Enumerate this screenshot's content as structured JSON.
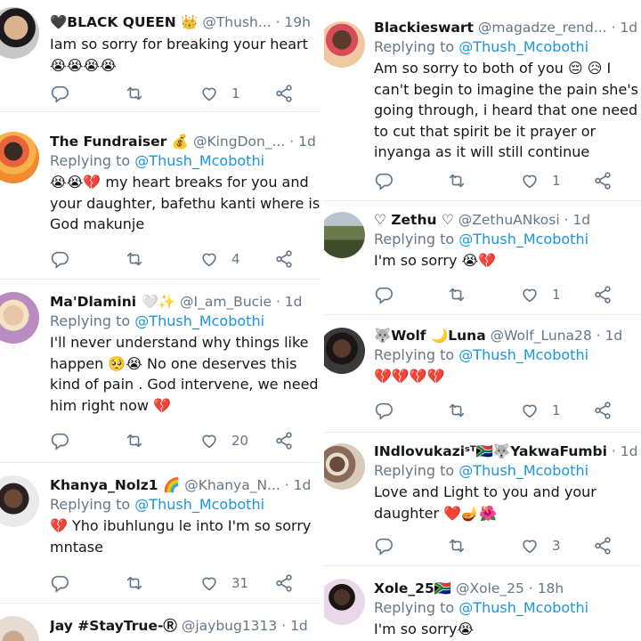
{
  "colors": {
    "mention": "#1b95e0",
    "muted": "#657786",
    "text": "#14171a",
    "divider": "#e6ecf0"
  },
  "left": [
    {
      "name": "🖤BLACK QUEEN 👑",
      "handle": "@Thush...",
      "time": "· 19h",
      "reply_prefix": "",
      "mention": "",
      "text": "Iam so sorry for breaking your heart 😭😭😭😭",
      "replies": "",
      "retweets": "",
      "likes": "1"
    },
    {
      "name": "The Fundraiser 💰",
      "handle": "@KingDon_...",
      "time": "· 1d",
      "reply_prefix": "Replying to ",
      "mention": "@Thush_Mcobothi",
      "text": "😭😭💔 my heart breaks for you and your daughter, bafethu kanti where is God makunje",
      "replies": "",
      "retweets": "",
      "likes": "4"
    },
    {
      "name": "Ma'Dlamini 🤍✨",
      "handle": "@I_am_Bucie",
      "time": "· 1d",
      "reply_prefix": "Replying to ",
      "mention": "@Thush_Mcobothi",
      "text": "I'll never understand why things like happen 🥺😭 No one deserves this kind of pain . God intervene, we need him right now 💔",
      "replies": "",
      "retweets": "",
      "likes": "20"
    },
    {
      "name": "Khanya_Nolz1 🌈",
      "handle": "@Khanya_N...",
      "time": "· 1d",
      "reply_prefix": "Replying to ",
      "mention": "@Thush_Mcobothi",
      "text": "💔 Yho ibuhlungu le into I'm so sorry mntase",
      "replies": "",
      "retweets": "",
      "likes": "31"
    },
    {
      "name": "Jay #StayTrue-Ⓡ",
      "handle": "@jaybug1313",
      "time": "· 1d",
      "reply_prefix": "",
      "mention": "",
      "text": "",
      "replies": "",
      "retweets": "",
      "likes": ""
    }
  ],
  "right": [
    {
      "name": "Blackieswart",
      "handle": "@magadze_rend...",
      "time": "· 1d",
      "reply_prefix": "Replying to ",
      "mention": "@Thush_Mcobothi",
      "text": "Am so sorry to both of you 😔 😥 I can't begin to imagine the pain she's going through,  i heard that one need to cut that spirit be it prayer or inyanga as it will still continue",
      "likes": "1"
    },
    {
      "name": "♡ Zethu ♡",
      "handle": "@ZethuANkosi",
      "time": "· 1d",
      "reply_prefix": "Replying to ",
      "mention": "@Thush_Mcobothi",
      "text": "I'm so sorry 😭💔",
      "likes": "1"
    },
    {
      "name": "🐺Wolf 🌙Luna",
      "handle": "@Wolf_Luna28",
      "time": "· 1d",
      "reply_prefix": "Replying to ",
      "mention": "@Thush_Mcobothi",
      "text": "💔💔💔💔",
      "likes": "1"
    },
    {
      "name": "INdlovukaziˢᵀ🇿🇦🐺YakwaFumbi",
      "handle": "",
      "time": "· 1d",
      "reply_prefix": "Replying to ",
      "mention": "@Thush_Mcobothi",
      "text": "Love and Light to you and your daughter ❤️🪔🌺",
      "likes": "3"
    },
    {
      "name": "Xole_25🇿🇦",
      "handle": "@Xole_25",
      "time": "· 18h",
      "reply_prefix": "Replying to ",
      "mention": "@Thush_Mcobothi",
      "text": "I'm so sorry😭",
      "likes": ""
    }
  ]
}
